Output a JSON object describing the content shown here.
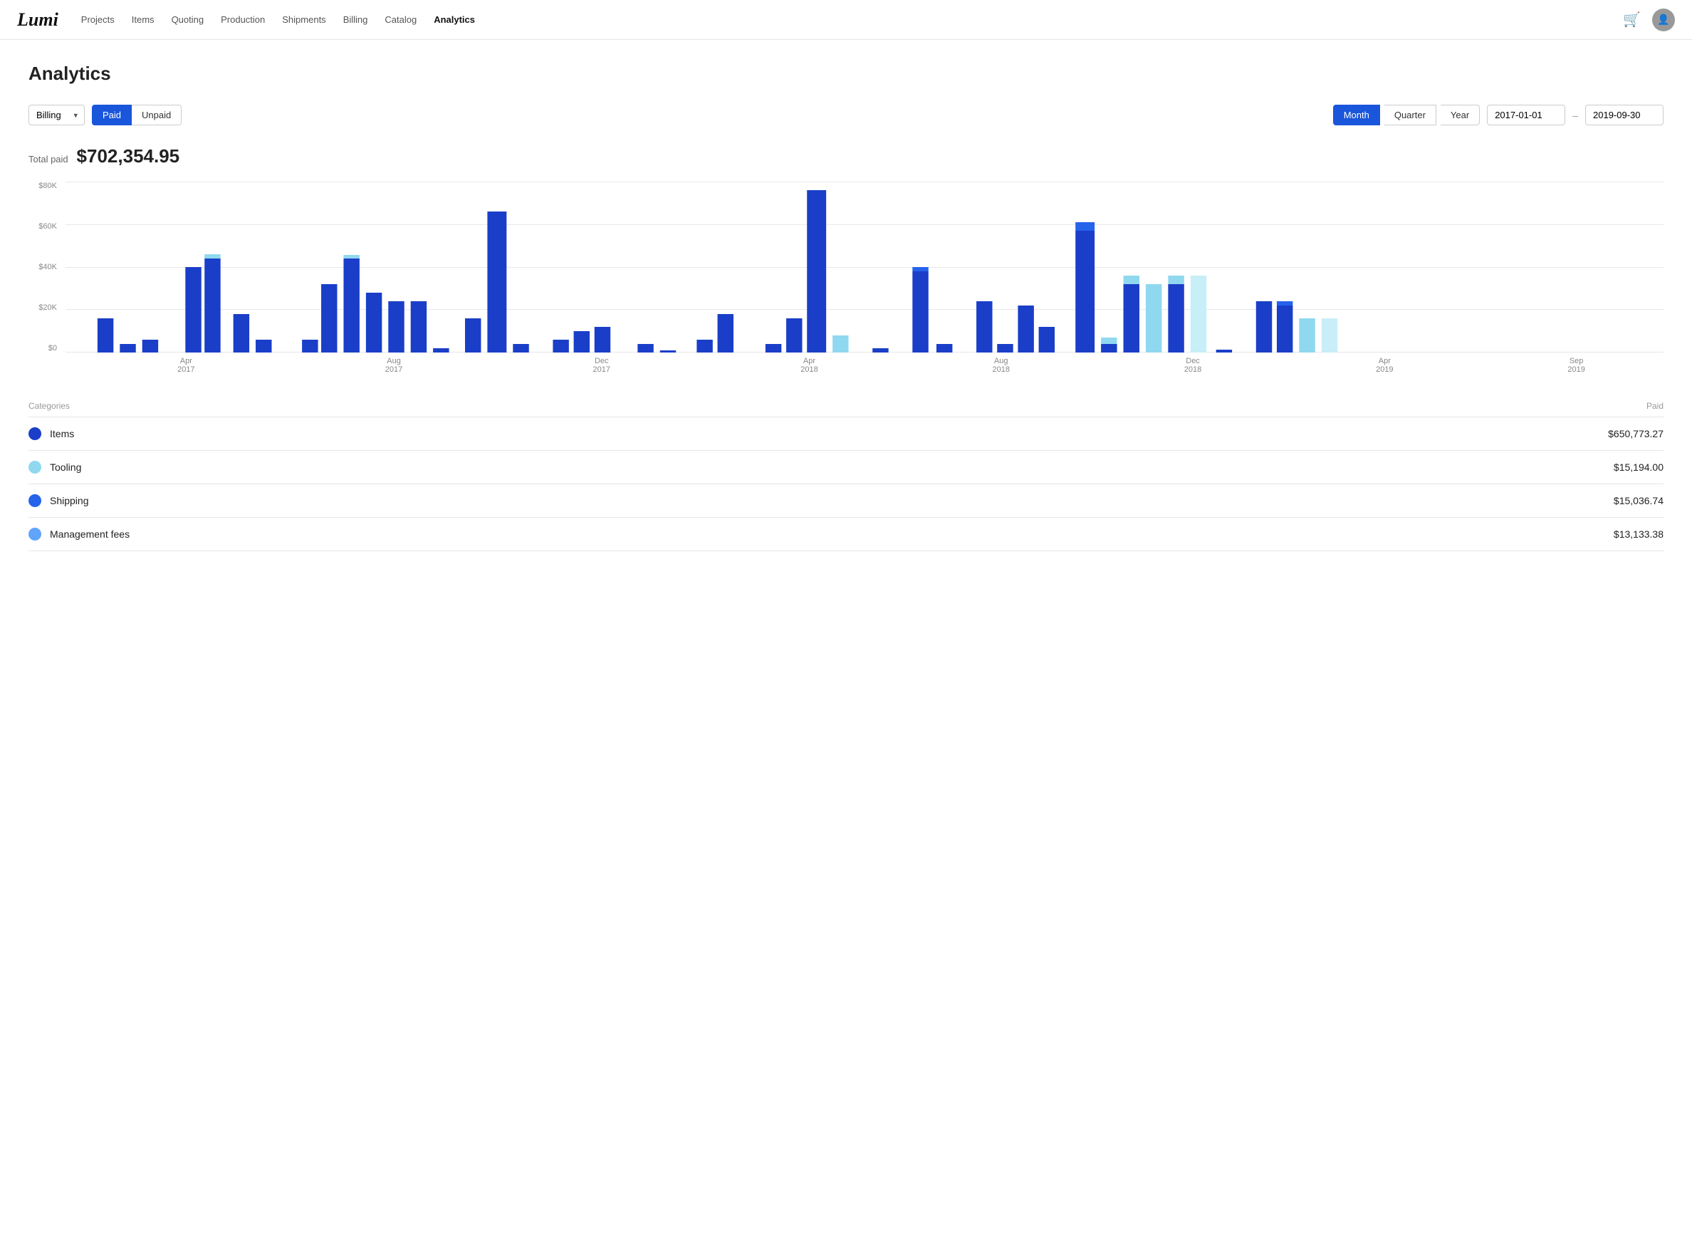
{
  "nav": {
    "logo": "Lumi",
    "links": [
      {
        "label": "Projects",
        "active": false
      },
      {
        "label": "Items",
        "active": false
      },
      {
        "label": "Quoting",
        "active": false
      },
      {
        "label": "Production",
        "active": false
      },
      {
        "label": "Shipments",
        "active": false
      },
      {
        "label": "Billing",
        "active": false
      },
      {
        "label": "Catalog",
        "active": false
      },
      {
        "label": "Analytics",
        "active": true
      }
    ]
  },
  "page": {
    "title": "Analytics"
  },
  "controls": {
    "billing_label": "Billing",
    "paid_label": "Paid",
    "unpaid_label": "Unpaid",
    "month_label": "Month",
    "quarter_label": "Quarter",
    "year_label": "Year",
    "date_from": "2017-01-01",
    "date_to": "2019-09-30"
  },
  "summary": {
    "label": "Total paid",
    "value": "$702,354.95"
  },
  "chart": {
    "y_labels": [
      "$80K",
      "$60K",
      "$40K",
      "$20K",
      "$0"
    ],
    "x_labels": [
      {
        "text": "Apr\n2017",
        "x_pct": 10
      },
      {
        "text": "Aug\n2017",
        "x_pct": 23
      },
      {
        "text": "Dec\n2017",
        "x_pct": 37
      },
      {
        "text": "Apr\n2018",
        "x_pct": 50
      },
      {
        "text": "Aug\n2018",
        "x_pct": 62
      },
      {
        "text": "Dec\n2018",
        "x_pct": 74
      },
      {
        "text": "Apr\n2019",
        "x_pct": 85
      },
      {
        "text": "Sep\n2019",
        "x_pct": 96
      }
    ]
  },
  "categories": {
    "header_name": "Categories",
    "header_paid": "Paid",
    "items": [
      {
        "name": "Items",
        "color": "#1a3ec8",
        "paid": "$650,773.27"
      },
      {
        "name": "Tooling",
        "color": "#90d8f0",
        "paid": "$15,194.00"
      },
      {
        "name": "Shipping",
        "color": "#2563eb",
        "paid": "$15,036.74"
      },
      {
        "name": "Management fees",
        "color": "#60a5fa",
        "paid": "$13,133.38"
      }
    ]
  }
}
